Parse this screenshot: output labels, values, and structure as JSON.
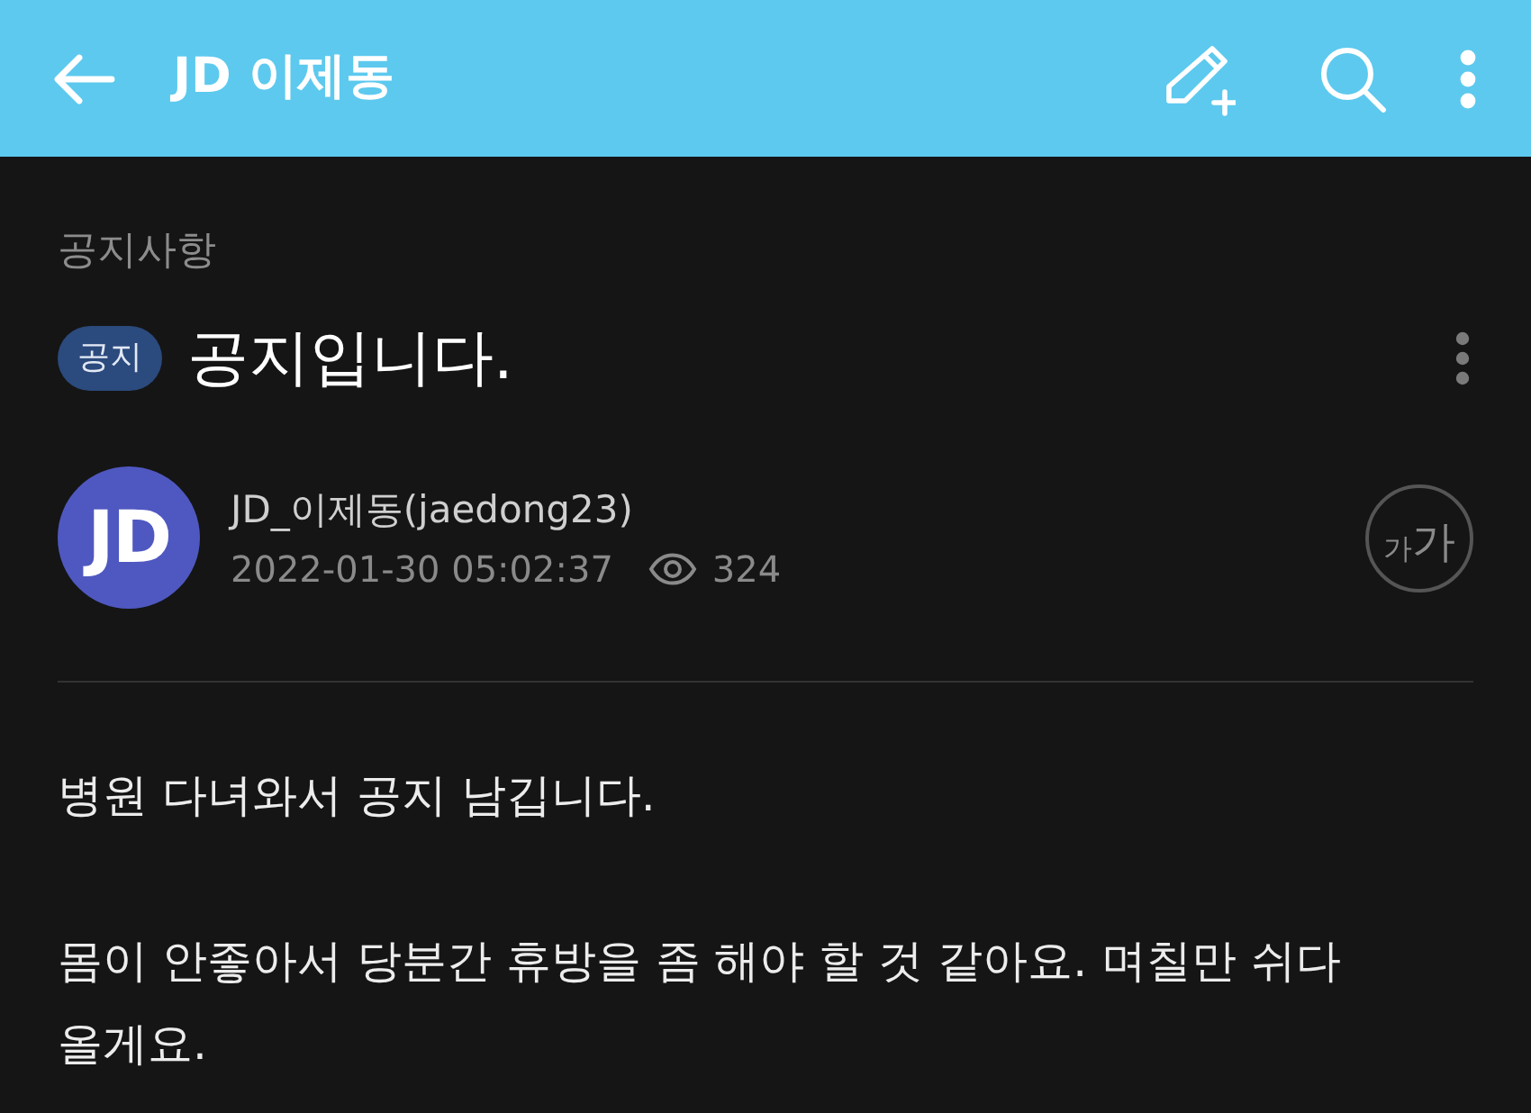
{
  "app_bar": {
    "title": "JD 이제동"
  },
  "board": "공지사항",
  "post": {
    "badge": "공지",
    "title": "공지입니다.",
    "author": {
      "initials": "JD",
      "name": "JD_이제동(jaedong23)",
      "date": "2022-01-30 05:02:37",
      "views": "324"
    },
    "font_size_button": {
      "small": "가",
      "large": "가"
    },
    "body": [
      "병원 다녀와서 공지 남깁니다.",
      "몸이 안좋아서 당분간 휴방을 좀 해야 할 것 같아요. 며칠만 쉬다 올게요."
    ]
  }
}
